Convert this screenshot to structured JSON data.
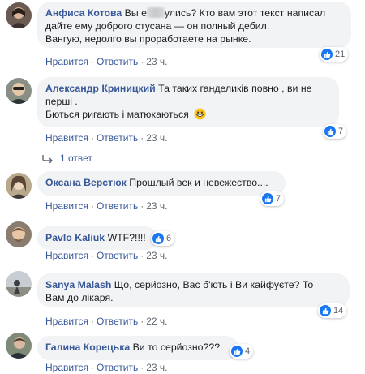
{
  "comments": [
    {
      "author": "Анфиса Котова",
      "text_before_blur": "Вы е",
      "text_after_blur": "улись? Кто вам этот текст написал",
      "line2": "дайте ему доброго стусана — он полный дебил.",
      "line3": "Вангую, недолго вы проработаете на рынке.",
      "like_label": "Нравится",
      "reply_label": "Ответить",
      "time": "23 ч.",
      "reactions": "21"
    },
    {
      "author": "Александр Криницкий",
      "text_line1": "Та таких ганделиків повно , ви не",
      "line2": "перші .",
      "line3": "Бються ригають і матюкаються",
      "like_label": "Нравится",
      "reply_label": "Ответить",
      "time": "23 ч.",
      "reactions": "7",
      "replies_label": "1 ответ"
    },
    {
      "author": "Оксана Верстюк",
      "text": "Прошлый век и невежество....",
      "like_label": "Нравится",
      "reply_label": "Ответить",
      "time": "23 ч.",
      "reactions": "7"
    },
    {
      "author": "Pavlo Kaliuk",
      "text": "WTF?!!!!",
      "like_label": "Нравится",
      "reply_label": "Ответить",
      "time": "23 ч.",
      "reactions": "6"
    },
    {
      "author": "Sanya Malash",
      "text_line1": "Що, серйозно, Вас б'ють і Ви кайфуєте? То",
      "line2": "Вам до лікаря.",
      "like_label": "Нравится",
      "reply_label": "Ответить",
      "time": "22 ч.",
      "reactions": "14"
    },
    {
      "author": "Галина Корецька",
      "text": "Ви то серйозно???",
      "like_label": "Нравится",
      "reply_label": "Ответить",
      "time": "23 ч.",
      "reactions": "4"
    }
  ],
  "separator": "·",
  "colors": {
    "author": "#385898",
    "bubble": "#f2f3f5",
    "like_blue": "#1877f2",
    "meta": "#606770"
  },
  "icons": {
    "reaction": "like-thumb-icon",
    "replies": "reply-arrow-icon",
    "emoji": "grinning-face-icon"
  }
}
